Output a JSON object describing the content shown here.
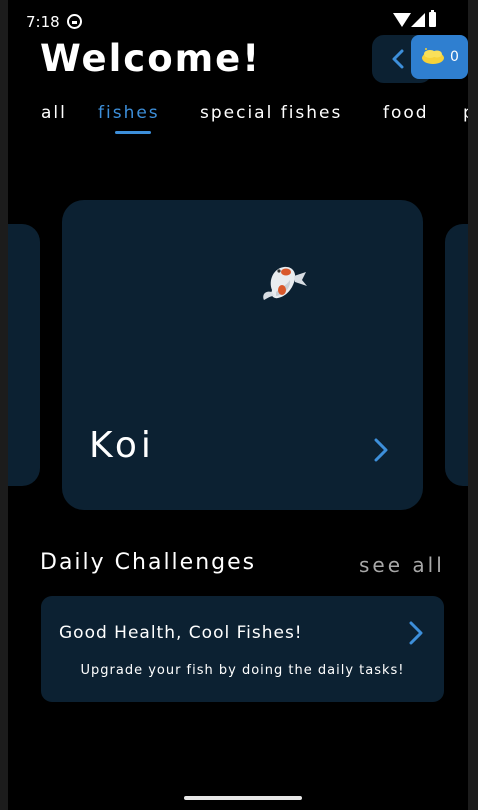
{
  "status_bar": {
    "time": "7:18"
  },
  "header": {
    "title": "Welcome!",
    "coins": "0"
  },
  "tabs": [
    {
      "label": "all"
    },
    {
      "label": "fishes"
    },
    {
      "label": "special fishes"
    },
    {
      "label": "food"
    },
    {
      "label": "p"
    }
  ],
  "active_tab": "fishes",
  "carousel": {
    "card": {
      "name": "Koi",
      "icon": "koi-fish-icon"
    }
  },
  "daily": {
    "title": "Daily Challenges",
    "see_all": "see all",
    "challenge": {
      "title": "Good Health, Cool Fishes!",
      "description": "Upgrade your fish by doing the daily tasks!"
    }
  },
  "colors": {
    "background": "#000000",
    "card": "#0c2132",
    "accent": "#3d8fda",
    "coin_badge": "#2f7fd0"
  }
}
